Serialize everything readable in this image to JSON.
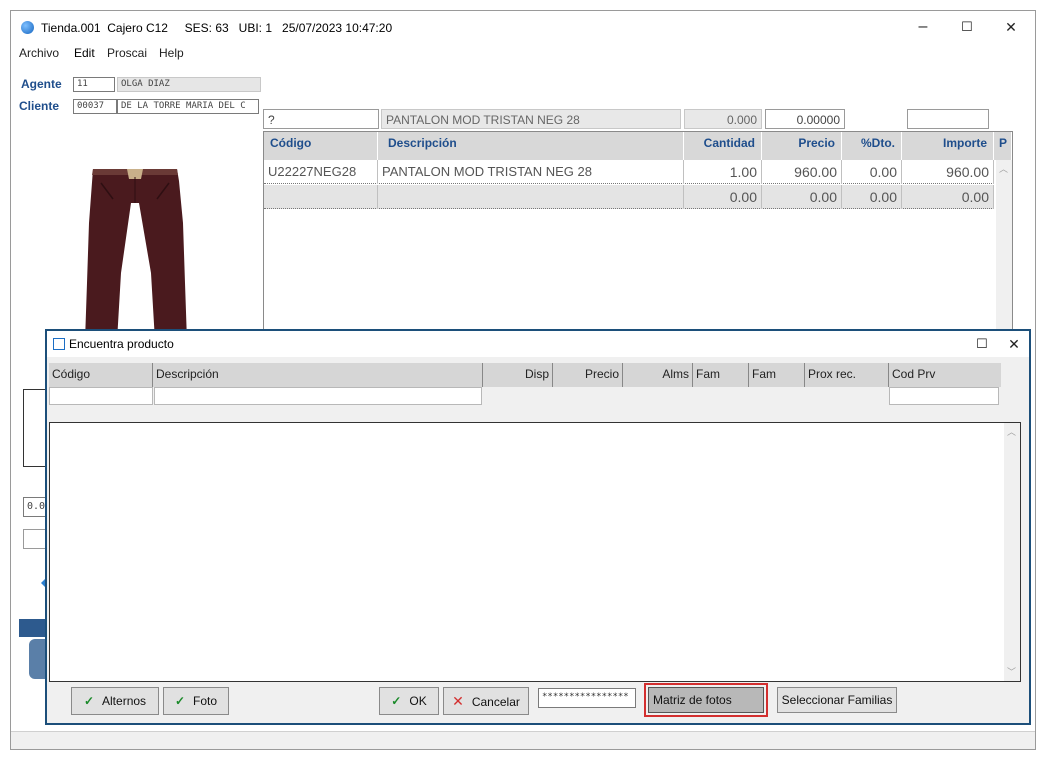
{
  "window": {
    "title": "Tienda.001  Cajero C12     SES: 63   UBI: 1   25/07/2023 10:47:20",
    "minimize_glyph": "–",
    "maximize_glyph": "☐",
    "close_glyph": "✕"
  },
  "menu": [
    "Archivo",
    "Edit",
    "Proscai",
    "Help"
  ],
  "header": {
    "agente_label": "Agente",
    "agente_code": "11",
    "agente_name": "OLGA DIAZ",
    "cliente_label": "Cliente",
    "cliente_code": "00037",
    "cliente_name": "DE LA TORRE MARIA DEL C",
    "search_value": "?",
    "product_desc": "PANTALON MOD TRISTAN NEG 28",
    "qty_value": "0.000",
    "price_value": "0.00000",
    "extra_value": ""
  },
  "grid": {
    "columns": [
      "Código",
      "Descripción",
      "Cantidad",
      "Precio",
      "%Dto.",
      "Importe",
      "P"
    ],
    "rows": [
      {
        "codigo": "U22227NEG28",
        "descripcion": "PANTALON MOD TRISTAN NEG 28",
        "cantidad": "1.00",
        "precio": "960.00",
        "dto": "0.00",
        "importe": "960.00"
      },
      {
        "codigo": "",
        "descripcion": "",
        "cantidad": "0.00",
        "precio": "0.00",
        "dto": "0.00",
        "importe": "0.00"
      }
    ]
  },
  "left_panel": {
    "residual_value": "0.0"
  },
  "dialog": {
    "title": "Encuentra producto",
    "columns": [
      "Código",
      "Descripción",
      "Disp",
      "Precio",
      "Alms",
      "Fam",
      "Fam",
      "Prox rec.",
      "Cod Prv"
    ],
    "buttons": {
      "alternos": "Alternos",
      "foto": "Foto",
      "ok": "OK",
      "cancelar": "Cancelar",
      "matriz": "Matriz de fotos",
      "familias": "Seleccionar Familias"
    },
    "password_mask": "****************",
    "check_glyph": "✓",
    "cancel_glyph": "✕",
    "highlight_color": "#d32f2f"
  },
  "colors": {
    "header_blue": "#1f4e8c",
    "dialog_border": "#1c4f7a"
  }
}
